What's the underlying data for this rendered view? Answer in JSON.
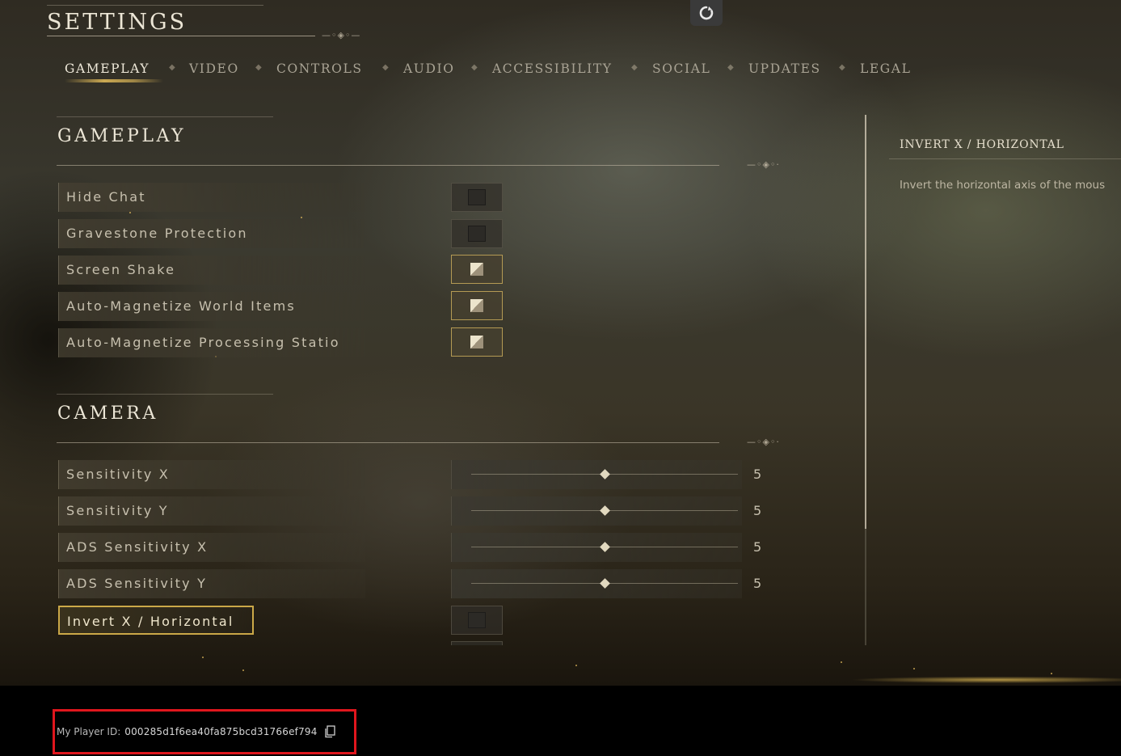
{
  "header": {
    "title": "SETTINGS"
  },
  "tabs": [
    {
      "label": "GAMEPLAY",
      "active": true
    },
    {
      "label": "VIDEO"
    },
    {
      "label": "CONTROLS"
    },
    {
      "label": "AUDIO"
    },
    {
      "label": "ACCESSIBILITY"
    },
    {
      "label": "SOCIAL"
    },
    {
      "label": "UPDATES"
    },
    {
      "label": "LEGAL"
    }
  ],
  "sections": {
    "gameplay": {
      "title": "GAMEPLAY",
      "rows": [
        {
          "label": "Hide Chat",
          "checked": false
        },
        {
          "label": "Gravestone Protection",
          "checked": false
        },
        {
          "label": "Screen Shake",
          "checked": true
        },
        {
          "label": "Auto-Magnetize World Items",
          "checked": true
        },
        {
          "label": "Auto-Magnetize Processing Statio",
          "checked": true
        }
      ]
    },
    "camera": {
      "title": "CAMERA",
      "sliders": [
        {
          "label": "Sensitivity X",
          "value": "5",
          "fraction": 0.5
        },
        {
          "label": "Sensitivity Y",
          "value": "5",
          "fraction": 0.5
        },
        {
          "label": "ADS Sensitivity X",
          "value": "5",
          "fraction": 0.5
        },
        {
          "label": "ADS Sensitivity Y",
          "value": "5",
          "fraction": 0.5
        }
      ],
      "invert_row": {
        "label": "Invert X / Horizontal",
        "checked": false
      }
    }
  },
  "info_panel": {
    "title": "INVERT X / HORIZONTAL",
    "description": "Invert the horizontal axis of the mous"
  },
  "footer": {
    "player_id_label": "My Player ID:",
    "player_id": "000285d1f6ea40fa875bcd31766ef794"
  },
  "icons": {
    "refresh": "refresh-icon",
    "copy": "copy-icon"
  },
  "colors": {
    "accent_gold": "#e6be5a",
    "highlight_red": "#e0161d"
  }
}
